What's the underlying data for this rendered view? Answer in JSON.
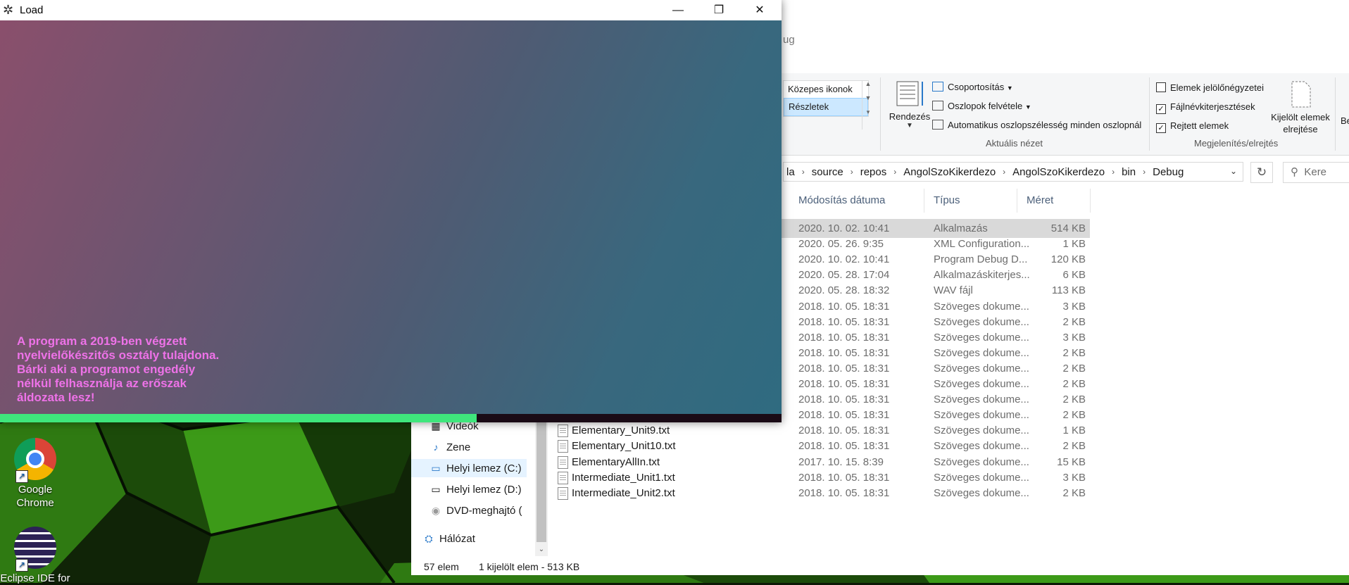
{
  "desktop": {
    "icons": [
      {
        "label": "Google Chrome",
        "name": "chrome"
      },
      {
        "label": "Eclipse IDE for",
        "name": "eclipse"
      }
    ]
  },
  "explorer": {
    "title_fragment": "ug",
    "ribbon": {
      "view_list": [
        "Közepes ikonok",
        "Részletek"
      ],
      "rendezes": "Rendezés",
      "csoportositas": "Csoportosítás",
      "oszlopok": "Oszlopok felvétele",
      "automatikus": "Automatikus oszlopszélesség minden oszlopnál",
      "aktualis_nezet": "Aktuális nézet",
      "elemek_jelolo": "Elemek jelölőnégyzetei",
      "fajlnev": "Fájlnévkiterjesztések",
      "rejtett": "Rejtett elemek",
      "kijelolt": "Kijelölt elemek elrejtése",
      "megjelenites": "Megjelenítés/elrejtés",
      "be_fragment": "Be",
      "checks": {
        "elemek_jelolo": false,
        "fajlnev": true,
        "rejtett": true
      }
    },
    "address": {
      "crumbs": [
        "la",
        "source",
        "repos",
        "AngolSzoKikerdezo",
        "AngolSzoKikerdezo",
        "bin",
        "Debug"
      ],
      "search_placeholder": "Kere"
    },
    "columns": {
      "date": "Módosítás dátuma",
      "type": "Típus",
      "size": "Méret"
    },
    "rows": [
      {
        "name": "",
        "date": "2020. 10. 02. 10:41",
        "type": "Alkalmazás",
        "size": "514 KB",
        "selected": true
      },
      {
        "name": "",
        "date": "2020. 05. 26. 9:35",
        "type": "XML Configuration...",
        "size": "1 KB"
      },
      {
        "name": "",
        "date": "2020. 10. 02. 10:41",
        "type": "Program Debug D...",
        "size": "120 KB"
      },
      {
        "name": "",
        "date": "2020. 05. 28. 17:04",
        "type": "Alkalmazáskiterjes...",
        "size": "6 KB"
      },
      {
        "name": "",
        "date": "2020. 05. 28. 18:32",
        "type": "WAV fájl",
        "size": "113 KB"
      },
      {
        "name": "",
        "date": "2018. 10. 05. 18:31",
        "type": "Szöveges dokume...",
        "size": "3 KB"
      },
      {
        "name": "",
        "date": "2018. 10. 05. 18:31",
        "type": "Szöveges dokume...",
        "size": "2 KB"
      },
      {
        "name": "",
        "date": "2018. 10. 05. 18:31",
        "type": "Szöveges dokume...",
        "size": "3 KB"
      },
      {
        "name": "",
        "date": "2018. 10. 05. 18:31",
        "type": "Szöveges dokume...",
        "size": "2 KB"
      },
      {
        "name": "",
        "date": "2018. 10. 05. 18:31",
        "type": "Szöveges dokume...",
        "size": "2 KB"
      },
      {
        "name": "",
        "date": "2018. 10. 05. 18:31",
        "type": "Szöveges dokume...",
        "size": "2 KB"
      },
      {
        "name": "Elementary_Unit7.txt",
        "date": "2018. 10. 05. 18:31",
        "type": "Szöveges dokume...",
        "size": "2 KB"
      },
      {
        "name": "Elementary_Unit8.txt",
        "date": "2018. 10. 05. 18:31",
        "type": "Szöveges dokume...",
        "size": "2 KB"
      },
      {
        "name": "Elementary_Unit9.txt",
        "date": "2018. 10. 05. 18:31",
        "type": "Szöveges dokume...",
        "size": "1 KB"
      },
      {
        "name": "Elementary_Unit10.txt",
        "date": "2018. 10. 05. 18:31",
        "type": "Szöveges dokume...",
        "size": "2 KB"
      },
      {
        "name": "ElementaryAllIn.txt",
        "date": "2017. 10. 15. 8:39",
        "type": "Szöveges dokume...",
        "size": "15 KB"
      },
      {
        "name": "Intermediate_Unit1.txt",
        "date": "2018. 10. 05. 18:31",
        "type": "Szöveges dokume...",
        "size": "3 KB"
      },
      {
        "name": "Intermediate_Unit2.txt",
        "date": "2018. 10. 05. 18:31",
        "type": "Szöveges dokume...",
        "size": "2 KB"
      }
    ],
    "nav": [
      {
        "label": "Videók",
        "icon": "video-icon"
      },
      {
        "label": "Zene",
        "icon": "music-icon"
      },
      {
        "label": "Helyi lemez (C:)",
        "icon": "windows-drive-icon",
        "selected": true
      },
      {
        "label": "Helyi lemez (D:)",
        "icon": "drive-icon"
      },
      {
        "label": "DVD-meghajtó (",
        "icon": "dvd-icon"
      },
      {
        "label": "Hálózat",
        "icon": "network-icon"
      }
    ],
    "status": {
      "count": "57 elem",
      "selection": "1 kijelölt elem - 513 KB"
    }
  },
  "load_window": {
    "title": "Load",
    "notice_lines": [
      "A program a 2019-ben végzett",
      "nyelvielőkészitős osztály tulajdona.",
      "Bárki aki a programot engedély",
      "nélkül felhasználja az erőszak",
      "áldozata lesz!"
    ],
    "progress_fraction": 0.61,
    "colors": {
      "progress": "#3fe67c",
      "notice": "#ee72e8"
    }
  }
}
